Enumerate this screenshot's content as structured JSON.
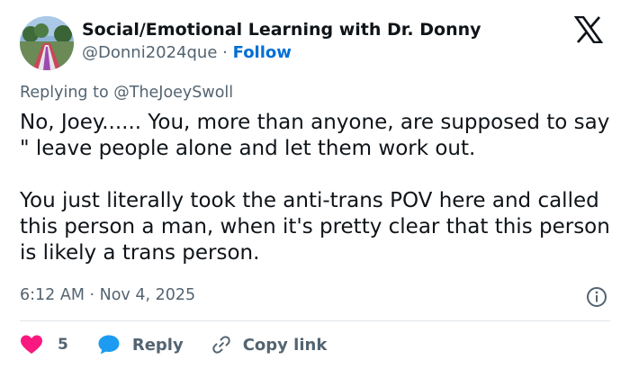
{
  "header": {
    "author_name": "Social/Emotional Learning with Dr. Donny",
    "handle": "@Donni2024que",
    "separator": "·",
    "follow_label": "Follow"
  },
  "icons": {
    "brand": "x-logo-icon",
    "info": "info-icon",
    "like": "heart-icon",
    "reply": "speech-bubble-icon",
    "copy": "link-icon"
  },
  "reply_context": {
    "prefix": "Replying to",
    "target": "@TheJoeySwoll"
  },
  "post": {
    "text": "No, Joey...... You, more than anyone, are supposed to say \" leave people alone and let them work out.\n\nYou just literally took the anti-trans POV here and called this person a man, when it's pretty clear that this person is likely a trans person.",
    "timestamp": "6:12 AM · Nov 4, 2025"
  },
  "actions": {
    "like_count": "5",
    "reply_label": "Reply",
    "copy_link_label": "Copy link"
  },
  "colors": {
    "link_blue": "#006fd6",
    "like_red": "#f91880",
    "reply_blue": "#1d9bf0",
    "muted": "#536471",
    "text": "#0f1419"
  }
}
